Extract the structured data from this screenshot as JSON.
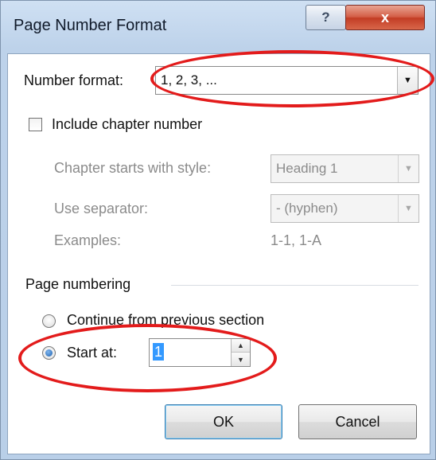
{
  "window": {
    "title": "Page Number Format",
    "help_label": "?",
    "close_label": "x"
  },
  "number_format": {
    "label": "Number format:",
    "value": "1, 2, 3, ..."
  },
  "chapter": {
    "include_label": "Include chapter number",
    "include_checked": false,
    "starts_with_label": "Chapter starts with style:",
    "starts_with_value": "Heading 1",
    "separator_label": "Use separator:",
    "separator_value": "-   (hyphen)",
    "examples_label": "Examples:",
    "examples_value": "1-1, 1-A"
  },
  "page_numbering": {
    "group_label": "Page numbering",
    "continue_label": "Continue from previous section",
    "start_at_label": "Start at:",
    "start_at_value": "1",
    "selected": "start_at"
  },
  "buttons": {
    "ok": "OK",
    "cancel": "Cancel"
  },
  "annotation_color": "#e31b1b"
}
